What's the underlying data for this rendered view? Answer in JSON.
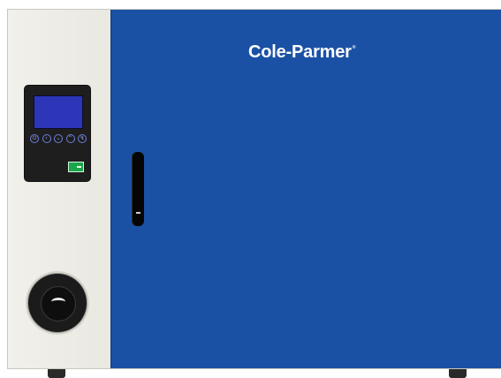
{
  "brand": {
    "name": "Cole-Parmer",
    "mark": "®"
  },
  "controller": {
    "keys": [
      {
        "name": "power-key",
        "glyph": "⏻"
      },
      {
        "name": "left-key",
        "glyph": "‹"
      },
      {
        "name": "down-key",
        "glyph": "⌄"
      },
      {
        "name": "up-key",
        "glyph": "⌃"
      },
      {
        "name": "set-key",
        "glyph": "↯"
      }
    ]
  },
  "colors": {
    "door": "#1b51a4",
    "body": "#ecebe4",
    "screen": "#2d35b8",
    "switch": "#1aa64a"
  }
}
